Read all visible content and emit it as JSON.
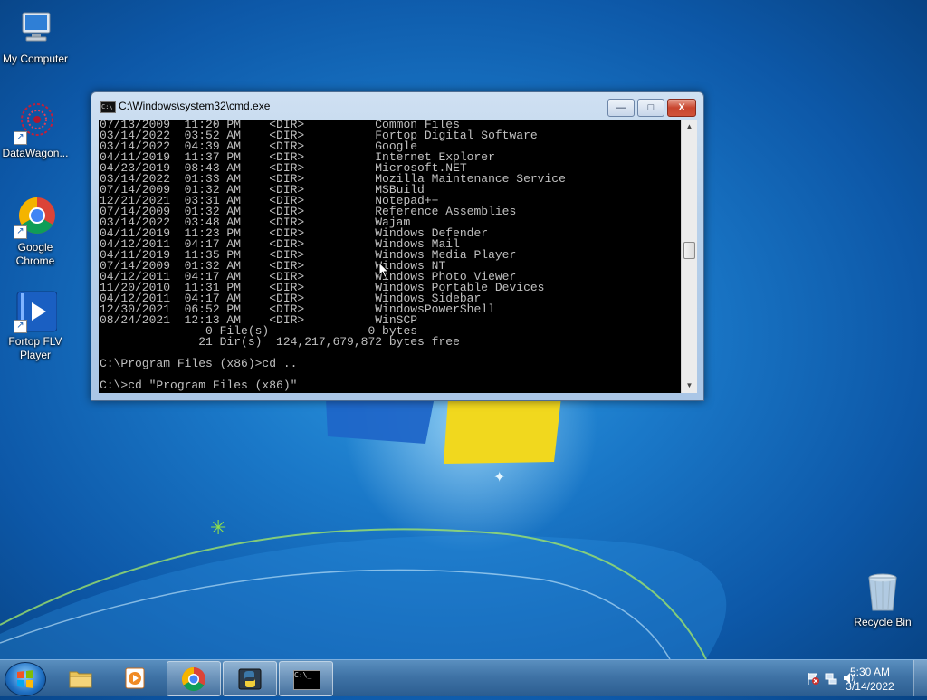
{
  "desktop": {
    "icons": [
      {
        "label": "My Computer"
      },
      {
        "label": "DataWagon..."
      },
      {
        "label": "Google Chrome"
      },
      {
        "label": "Fortop FLV Player"
      },
      {
        "label": "Recycle Bin"
      }
    ]
  },
  "window": {
    "title": "C:\\Windows\\system32\\cmd.exe",
    "controls": {
      "minimize": "—",
      "maximize": "□",
      "close": "X"
    },
    "console_lines": [
      "07/13/2009  11:20 PM    <DIR>          Common Files",
      "03/14/2022  03:52 AM    <DIR>          Fortop Digital Software",
      "03/14/2022  04:39 AM    <DIR>          Google",
      "04/11/2019  11:37 PM    <DIR>          Internet Explorer",
      "04/23/2019  08:43 AM    <DIR>          Microsoft.NET",
      "03/14/2022  01:33 AM    <DIR>          Mozilla Maintenance Service",
      "07/14/2009  01:32 AM    <DIR>          MSBuild",
      "12/21/2021  03:31 AM    <DIR>          Notepad++",
      "07/14/2009  01:32 AM    <DIR>          Reference Assemblies",
      "03/14/2022  03:48 AM    <DIR>          Wajam",
      "04/11/2019  11:23 PM    <DIR>          Windows Defender",
      "04/12/2011  04:17 AM    <DIR>          Windows Mail",
      "04/11/2019  11:35 PM    <DIR>          Windows Media Player",
      "07/14/2009  01:32 AM    <DIR>          Windows NT",
      "04/12/2011  04:17 AM    <DIR>          Windows Photo Viewer",
      "11/20/2010  11:31 PM    <DIR>          Windows Portable Devices",
      "04/12/2011  04:17 AM    <DIR>          Windows Sidebar",
      "12/30/2021  06:52 PM    <DIR>          WindowsPowerShell",
      "08/24/2021  12:13 AM    <DIR>          WinSCP",
      "               0 File(s)              0 bytes",
      "              21 Dir(s)  124,217,679,872 bytes free",
      "",
      "C:\\Program Files (x86)>cd ..",
      "",
      "C:\\>cd \"Program Files (x86)\""
    ],
    "scrollbar": {
      "up": "▲",
      "down": "▼"
    }
  },
  "taskbar": {
    "items": [
      {
        "name": "windows-explorer"
      },
      {
        "name": "fortop-flv-player"
      },
      {
        "name": "google-chrome"
      },
      {
        "name": "python"
      },
      {
        "name": "command-prompt",
        "icon_text": "C:\\_"
      }
    ],
    "clock": {
      "time": "5:30 AM",
      "date": "3/14/2022"
    }
  }
}
